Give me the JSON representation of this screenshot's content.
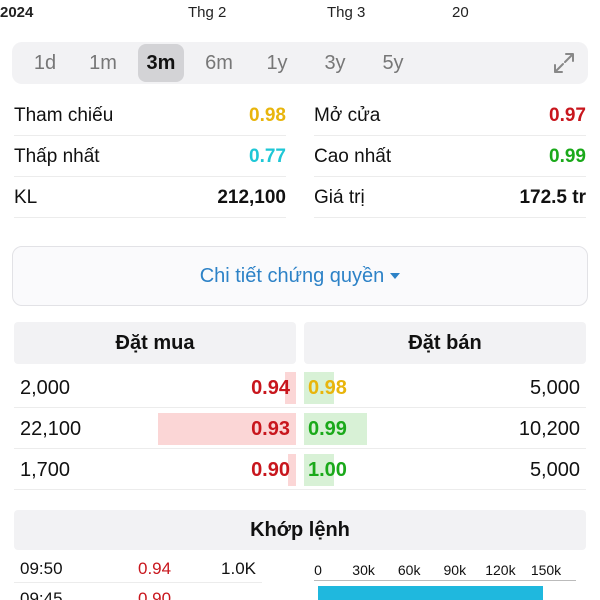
{
  "timeline": {
    "year": "2024",
    "months": [
      "Thg 2",
      "Thg 3",
      "20"
    ]
  },
  "ranges": [
    "1d",
    "1m",
    "3m",
    "6m",
    "1y",
    "3y",
    "5y"
  ],
  "active_range": "3m",
  "stats": {
    "tham_chieu": {
      "label": "Tham chiếu",
      "value": "0.98"
    },
    "mo_cua": {
      "label": "Mở cửa",
      "value": "0.97"
    },
    "thap_nhat": {
      "label": "Thấp nhất",
      "value": "0.77"
    },
    "cao_nhat": {
      "label": "Cao nhất",
      "value": "0.99"
    },
    "kl": {
      "label": "KL",
      "value": "212,100"
    },
    "gia_tri": {
      "label": "Giá trị",
      "value": "172.5 tr"
    }
  },
  "detail_link": "Chi tiết chứng quyền",
  "orderbook": {
    "buy_title": "Đặt mua",
    "sell_title": "Đặt bán",
    "rows": [
      {
        "buy_vol": "2,000",
        "buy_price": "0.94",
        "sell_price": "0.98",
        "sell_vol": "5,000",
        "buy_frac": 0.04,
        "sell_frac": 0.11,
        "sell_color": "#e8b50c"
      },
      {
        "buy_vol": "22,100",
        "buy_price": "0.93",
        "sell_price": "0.99",
        "sell_vol": "10,200",
        "buy_frac": 0.5,
        "sell_frac": 0.23,
        "sell_color": "#1aa91a"
      },
      {
        "buy_vol": "1,700",
        "buy_price": "0.90",
        "sell_price": "1.00",
        "sell_vol": "5,000",
        "buy_frac": 0.03,
        "sell_frac": 0.11,
        "sell_color": "#1aa91a"
      }
    ]
  },
  "match": {
    "title": "Khớp lệnh",
    "trades": [
      {
        "time": "09:50",
        "price": "0.94",
        "vol": "1.0K"
      },
      {
        "time": "09:45",
        "price": "0.90",
        "vol": ""
      }
    ],
    "volume_axis": [
      "0",
      "30k",
      "60k",
      "90k",
      "120k",
      "150k"
    ],
    "volume_max": 160000,
    "volume_bar_value": 148000
  },
  "colors": {
    "ref": "#e8b50c",
    "down": "#c8161d",
    "floor": "#1ec7d6",
    "up": "#1aa91a",
    "link": "#2d82c7",
    "volume": "#1fb8de"
  }
}
